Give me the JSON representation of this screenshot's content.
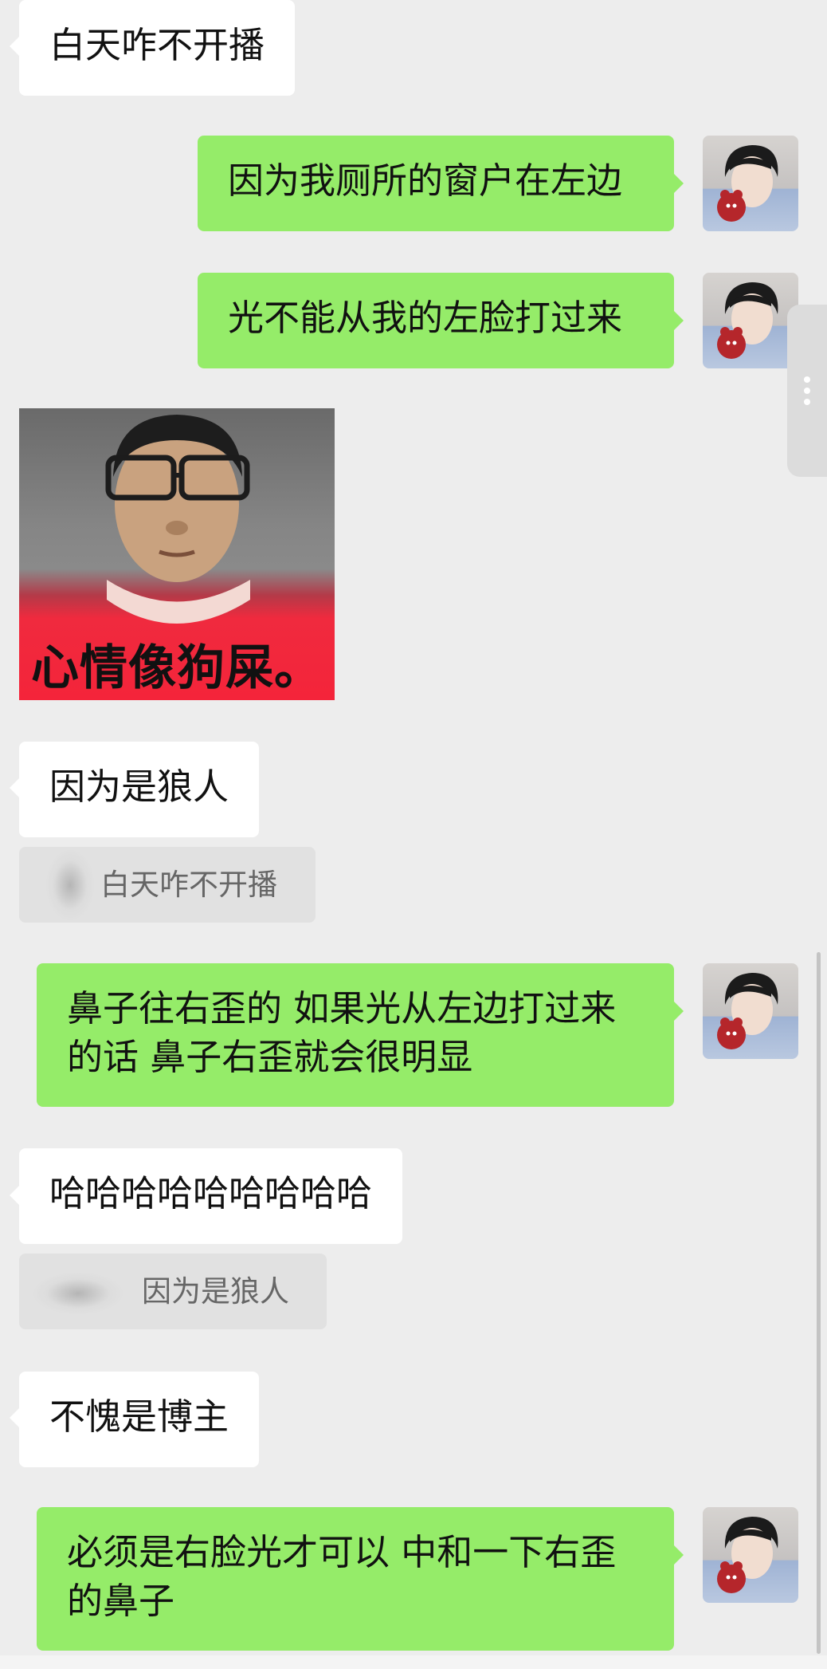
{
  "messages": [
    {
      "side": "in",
      "text": "白天咋不开播"
    },
    {
      "side": "out",
      "text": "因为我厕所的窗户在左边"
    },
    {
      "side": "out",
      "text": "光不能从我的左脸打过来"
    },
    {
      "side": "in",
      "type": "sticker",
      "caption": "心情像狗屎。"
    },
    {
      "side": "in",
      "text": "因为是狼人",
      "quote": "白天咋不开播"
    },
    {
      "side": "out",
      "text": "鼻子往右歪的 如果光从左边打过来的话 鼻子右歪就会很明显"
    },
    {
      "side": "in",
      "text": "哈哈哈哈哈哈哈哈哈",
      "quote": "因为是狼人"
    },
    {
      "side": "in",
      "text": "不愧是博主"
    },
    {
      "side": "out",
      "text": "必须是右脸光才可以 中和一下右歪的鼻子"
    }
  ],
  "colors": {
    "background": "#ededed",
    "incoming_bubble": "#ffffff",
    "outgoing_bubble": "#95ec69",
    "quote_box": "#e1e1e1"
  },
  "icons": {
    "avatar": "user-avatar",
    "more": "more-vertical-icon"
  }
}
